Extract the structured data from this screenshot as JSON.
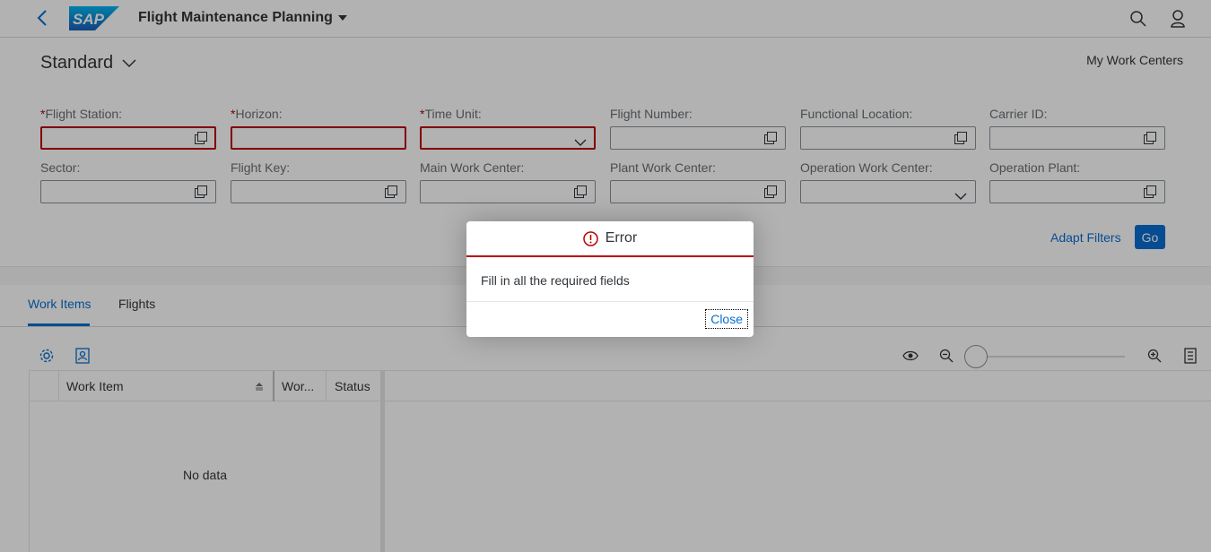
{
  "shell": {
    "logo_text": "SAP",
    "app_title": "Flight Maintenance Planning"
  },
  "header": {
    "variant": "Standard",
    "my_work_centers": "My Work Centers",
    "required_mark": "*",
    "fields": [
      {
        "label": "Flight Station:",
        "required": true,
        "error": true,
        "type": "valuehelp"
      },
      {
        "label": "Horizon:",
        "required": true,
        "error": true,
        "type": "text"
      },
      {
        "label": "Time Unit:",
        "required": true,
        "error": true,
        "type": "select"
      },
      {
        "label": "Flight Number:",
        "required": false,
        "error": false,
        "type": "valuehelp"
      },
      {
        "label": "Functional Location:",
        "required": false,
        "error": false,
        "type": "valuehelp"
      },
      {
        "label": "Carrier ID:",
        "required": false,
        "error": false,
        "type": "valuehelp"
      },
      {
        "label": "Sector:",
        "required": false,
        "error": false,
        "type": "valuehelp"
      },
      {
        "label": "Flight Key:",
        "required": false,
        "error": false,
        "type": "valuehelp"
      },
      {
        "label": "Main Work Center:",
        "required": false,
        "error": false,
        "type": "valuehelp"
      },
      {
        "label": "Plant Work Center:",
        "required": false,
        "error": false,
        "type": "valuehelp"
      },
      {
        "label": "Operation Work Center:",
        "required": false,
        "error": false,
        "type": "select"
      },
      {
        "label": "Operation Plant:",
        "required": false,
        "error": false,
        "type": "valuehelp"
      }
    ],
    "adapt_filters": "Adapt Filters",
    "go": "Go"
  },
  "tabs": [
    {
      "label": "Work Items",
      "active": true
    },
    {
      "label": "Flights",
      "active": false
    }
  ],
  "gantt": {
    "columns": [
      "Work Item",
      "Wor...",
      "Status"
    ],
    "no_data": "No data",
    "zoom_fraction": 0
  },
  "dialog": {
    "title": "Error",
    "message": "Fill in all the required fields",
    "close": "Close"
  },
  "colors": {
    "brand": "#0a6ed1",
    "error": "#bb0000"
  }
}
